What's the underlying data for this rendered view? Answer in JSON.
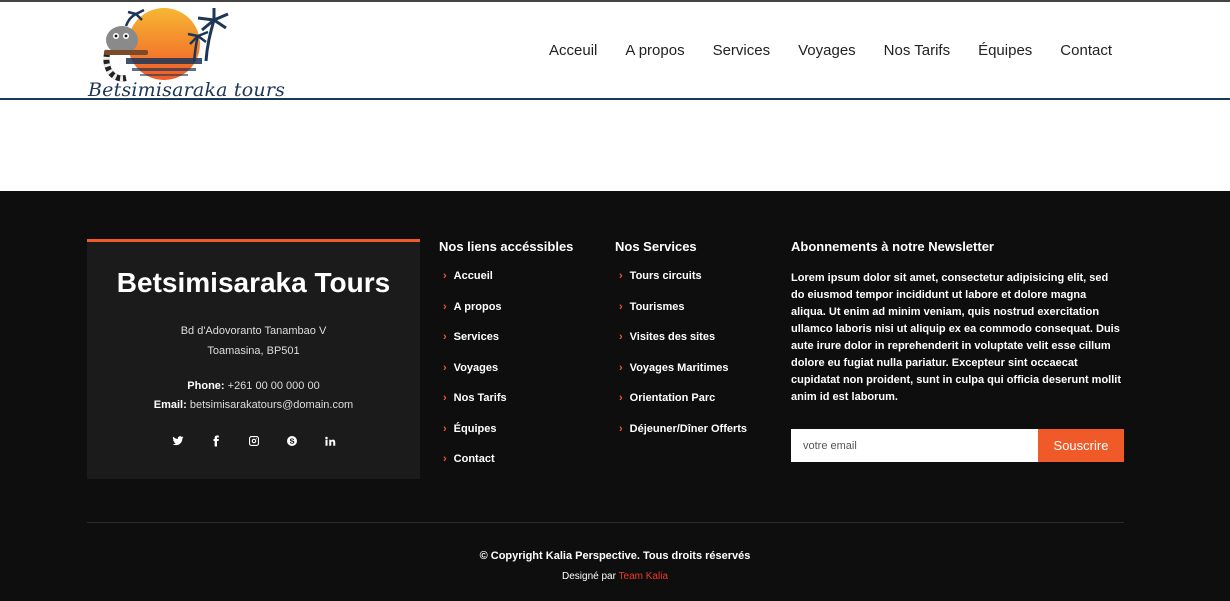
{
  "brand": {
    "logo_text": "Betsimisaraka tours"
  },
  "nav": {
    "items": [
      {
        "label": "Acceuil"
      },
      {
        "label": "A propos"
      },
      {
        "label": "Services"
      },
      {
        "label": "Voyages"
      },
      {
        "label": "Nos Tarifs"
      },
      {
        "label": "Équipes"
      },
      {
        "label": "Contact"
      }
    ]
  },
  "footer": {
    "card": {
      "title": "Betsimisaraka Tours",
      "address_line1": "Bd d'Adovoranto Tanambao V",
      "address_line2": "Toamasina, BP501",
      "phone_label": "Phone:",
      "phone": "+261 00 00 000 00",
      "email_label": "Email:",
      "email": "betsimisarakatours@domain.com",
      "socials": [
        "twitter-icon",
        "facebook-icon",
        "instagram-icon",
        "skype-icon",
        "linkedin-icon"
      ]
    },
    "links": {
      "title": "Nos liens accéssibles",
      "items": [
        "Accueil",
        "A propos",
        "Services",
        "Voyages",
        "Nos Tarifs",
        "Équipes",
        "Contact"
      ]
    },
    "services": {
      "title": "Nos Services",
      "items": [
        "Tours circuits",
        "Tourismes",
        "Visites des sites",
        "Voyages Maritimes",
        "Orientation Parc",
        "Déjeuner/Dîner Offerts"
      ]
    },
    "newsletter": {
      "title": "Abonnements à notre Newsletter",
      "text": "Lorem ipsum dolor sit amet, consectetur adipisicing elit, sed do eiusmod tempor incididunt ut labore et dolore magna aliqua. Ut enim ad minim veniam, quis nostrud exercitation ullamco laboris nisi ut aliquip ex ea commodo consequat. Duis aute irure dolor in reprehenderit in voluptate velit esse cillum dolore eu fugiat nulla pariatur. Excepteur sint occaecat cupidatat non proident, sunt in culpa qui officia deserunt mollit anim id est laborum.",
      "placeholder": "votre email",
      "button": "Souscrire"
    },
    "copyright": {
      "symbol": "©",
      "prefix": "Copyright",
      "company": "Kalia Perspective",
      "suffix": ". Tous droits réservés"
    },
    "credit": {
      "prefix": "Designé par",
      "author": "Team Kalia"
    }
  },
  "colors": {
    "accent": "#f05a28",
    "footer_bg": "#0e0e0e",
    "card_bg": "#1b1b1b",
    "header_border": "#183b56"
  }
}
